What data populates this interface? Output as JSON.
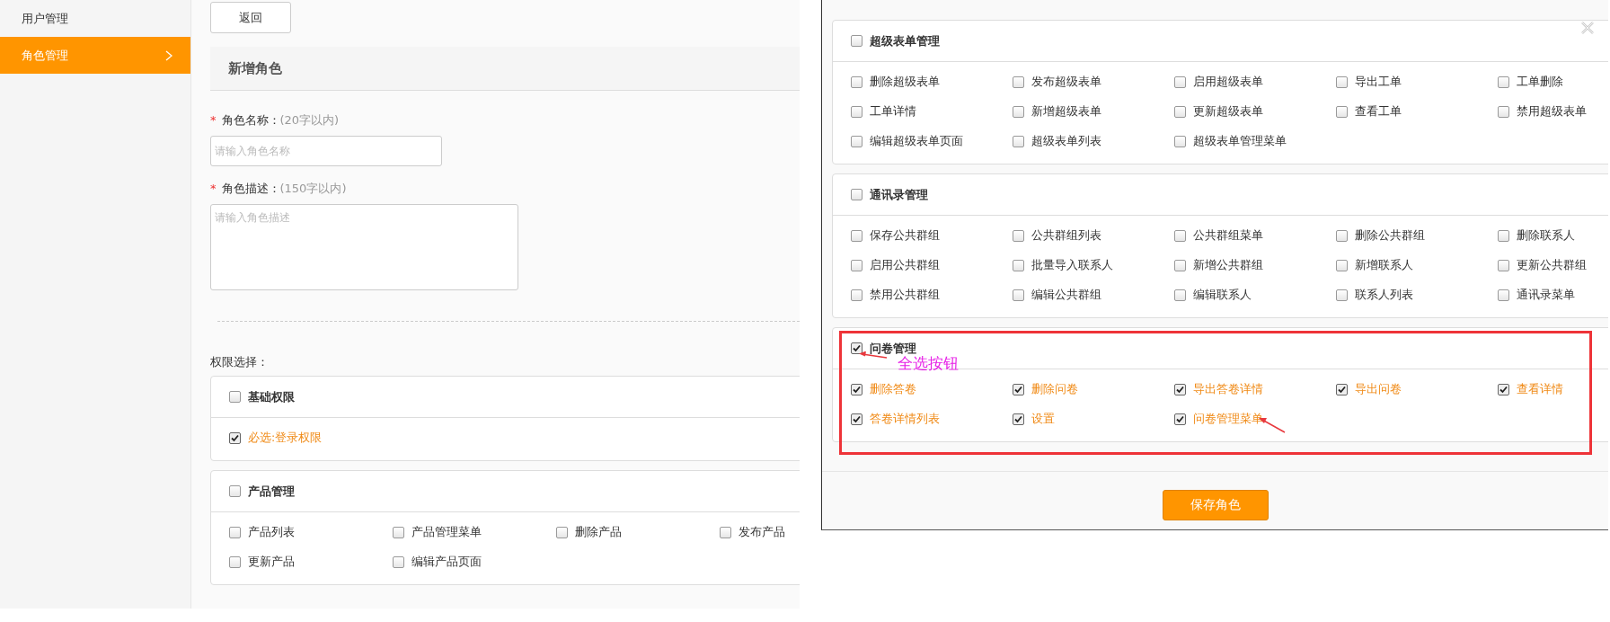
{
  "left": {
    "sidebar": {
      "items": [
        {
          "label": "用户管理",
          "selected": false
        },
        {
          "label": "角色管理",
          "selected": true
        }
      ]
    },
    "back_button": "返回",
    "section_title": "新增角色",
    "fields": [
      {
        "kind": "input",
        "marker": "*",
        "label": "角色名称：",
        "hint": "(20字以内)",
        "placeholder": "请输入角色名称"
      },
      {
        "kind": "textarea",
        "marker": "*",
        "label": "角色描述：",
        "hint": "(150字以内)",
        "placeholder": "请输入角色描述"
      }
    ],
    "permissions_label": "权限选择：",
    "groups": [
      {
        "title": "基础权限",
        "checked": false,
        "items": [
          {
            "label": "必选:登录权限",
            "checked": true
          }
        ]
      },
      {
        "title": "产品管理",
        "checked": false,
        "items": [
          {
            "label": "产品列表",
            "checked": false
          },
          {
            "label": "产品管理菜单",
            "checked": false
          },
          {
            "label": "删除产品",
            "checked": false
          },
          {
            "label": "发布产品",
            "checked": false
          },
          {
            "label": "更新产品",
            "checked": false
          },
          {
            "label": "编辑产品页面",
            "checked": false
          }
        ]
      }
    ]
  },
  "right": {
    "groups": [
      {
        "title": "超级表单管理",
        "checked": false,
        "highlighted": false,
        "items": [
          {
            "label": "删除超级表单",
            "checked": false
          },
          {
            "label": "发布超级表单",
            "checked": false
          },
          {
            "label": "启用超级表单",
            "checked": false
          },
          {
            "label": "导出工单",
            "checked": false
          },
          {
            "label": "工单删除",
            "checked": false
          },
          {
            "label": "工单详情",
            "checked": false
          },
          {
            "label": "新增超级表单",
            "checked": false
          },
          {
            "label": "更新超级表单",
            "checked": false
          },
          {
            "label": "查看工单",
            "checked": false
          },
          {
            "label": "禁用超级表单",
            "checked": false
          },
          {
            "label": "编辑超级表单页面",
            "checked": false
          },
          {
            "label": "超级表单列表",
            "checked": false
          },
          {
            "label": "超级表单管理菜单",
            "checked": false
          }
        ]
      },
      {
        "title": "通讯录管理",
        "checked": false,
        "highlighted": false,
        "items": [
          {
            "label": "保存公共群组",
            "checked": false
          },
          {
            "label": "公共群组列表",
            "checked": false
          },
          {
            "label": "公共群组菜单",
            "checked": false
          },
          {
            "label": "删除公共群组",
            "checked": false
          },
          {
            "label": "删除联系人",
            "checked": false
          },
          {
            "label": "启用公共群组",
            "checked": false
          },
          {
            "label": "批量导入联系人",
            "checked": false
          },
          {
            "label": "新增公共群组",
            "checked": false
          },
          {
            "label": "新增联系人",
            "checked": false
          },
          {
            "label": "更新公共群组",
            "checked": false
          },
          {
            "label": "禁用公共群组",
            "checked": false
          },
          {
            "label": "编辑公共群组",
            "checked": false
          },
          {
            "label": "编辑联系人",
            "checked": false
          },
          {
            "label": "联系人列表",
            "checked": false
          },
          {
            "label": "通讯录菜单",
            "checked": false
          }
        ]
      },
      {
        "title": "问卷管理",
        "checked": true,
        "highlighted": true,
        "items": [
          {
            "label": "删除答卷",
            "checked": true
          },
          {
            "label": "删除问卷",
            "checked": true
          },
          {
            "label": "导出答卷详情",
            "checked": true
          },
          {
            "label": "导出问卷",
            "checked": true
          },
          {
            "label": "查看详情",
            "checked": true
          },
          {
            "label": "答卷详情列表",
            "checked": true
          },
          {
            "label": "设置",
            "checked": true
          },
          {
            "label": "问卷管理菜单",
            "checked": true
          }
        ]
      }
    ],
    "annotation": "全选按钮",
    "save_button": "保存角色"
  }
}
